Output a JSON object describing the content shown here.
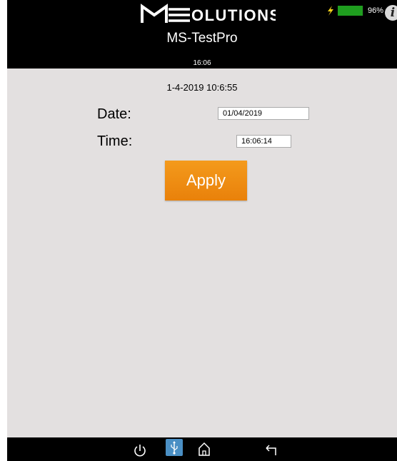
{
  "header": {
    "logo_text": "MSOLUTIONS",
    "app_title": "MS-TestPro",
    "clock": "16:06",
    "battery": {
      "percent_label": "96%",
      "level": 0.96,
      "fill_color": "#1f9e1f",
      "charging_icon": "lightning-icon"
    },
    "info_icon": "info-icon",
    "info_glyph": "i"
  },
  "main": {
    "datetime_readout": "1-4-2019 10:6:55",
    "date_label": "Date:",
    "date_value": "01/04/2019",
    "time_label": "Time:",
    "time_value": "16:06:14",
    "apply_label": "Apply",
    "apply_color": "#f08c12",
    "background_color": "#e3e0e0"
  },
  "navbar": {
    "items": [
      "power-icon",
      "usb-icon",
      "home-icon",
      "back-icon"
    ]
  }
}
